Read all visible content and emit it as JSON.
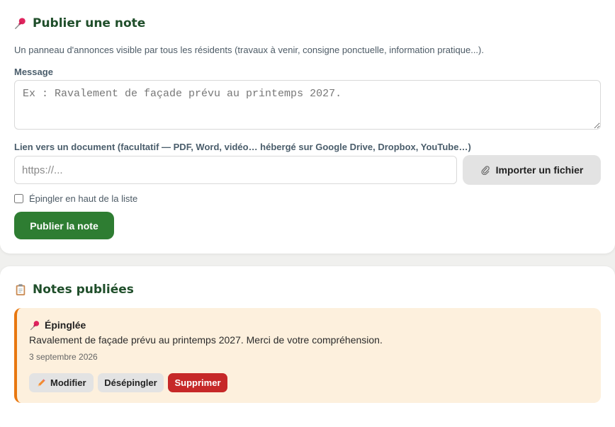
{
  "publish": {
    "title": "Publier une note",
    "description": "Un panneau d'annonces visible par tous les résidents (travaux à venir, consigne ponctuelle, information pratique...).",
    "message_label": "Message",
    "message_placeholder": "Ex : Ravalement de façade prévu au printemps 2027.",
    "message_value": "",
    "link_label": "Lien vers un document (facultatif — PDF, Word, vidéo… hébergé sur Google Drive, Dropbox, YouTube…)",
    "link_placeholder": "https://...",
    "link_value": "",
    "import_button": "Importer un fichier",
    "pin_checkbox_label": "Épingler en haut de la liste",
    "pin_checked": false,
    "publish_button": "Publier la note"
  },
  "notes": {
    "title": "Notes publiées",
    "items": [
      {
        "tag": "Épinglée",
        "text": "Ravalement de façade prévu au printemps 2027. Merci de votre compréhension.",
        "date": "3 septembre 2026",
        "edit_label": "Modifier",
        "unpin_label": "Désépingler",
        "delete_label": "Supprimer"
      }
    ]
  },
  "icons": {
    "publish_title_icon": "pushpin-icon",
    "notes_title_icon": "clipboard-icon",
    "import_icon": "paperclip-icon",
    "note_tag_icon": "pushpin-icon",
    "edit_icon": "pencil-icon"
  },
  "colors": {
    "primary_green": "#2e7d32",
    "title_green": "#1f4e2a",
    "note_background": "#fdf0dd",
    "note_accent": "#e8770f",
    "delete_red": "#c62828"
  }
}
